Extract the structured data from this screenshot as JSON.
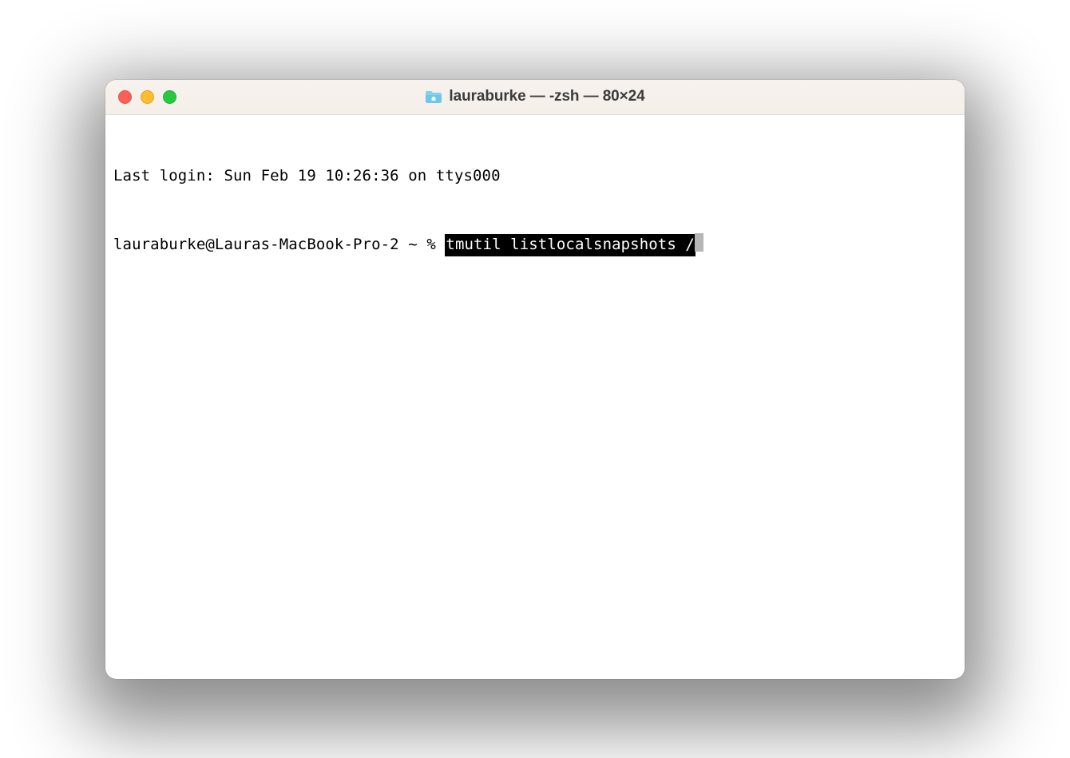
{
  "window": {
    "title": "lauraburke — -zsh — 80×24"
  },
  "terminal": {
    "last_login": "Last login: Sun Feb 19 10:26:36 on ttys000",
    "prompt": "lauraburke@Lauras-MacBook-Pro-2 ~ % ",
    "command": "tmutil listlocalsnapshots /"
  }
}
